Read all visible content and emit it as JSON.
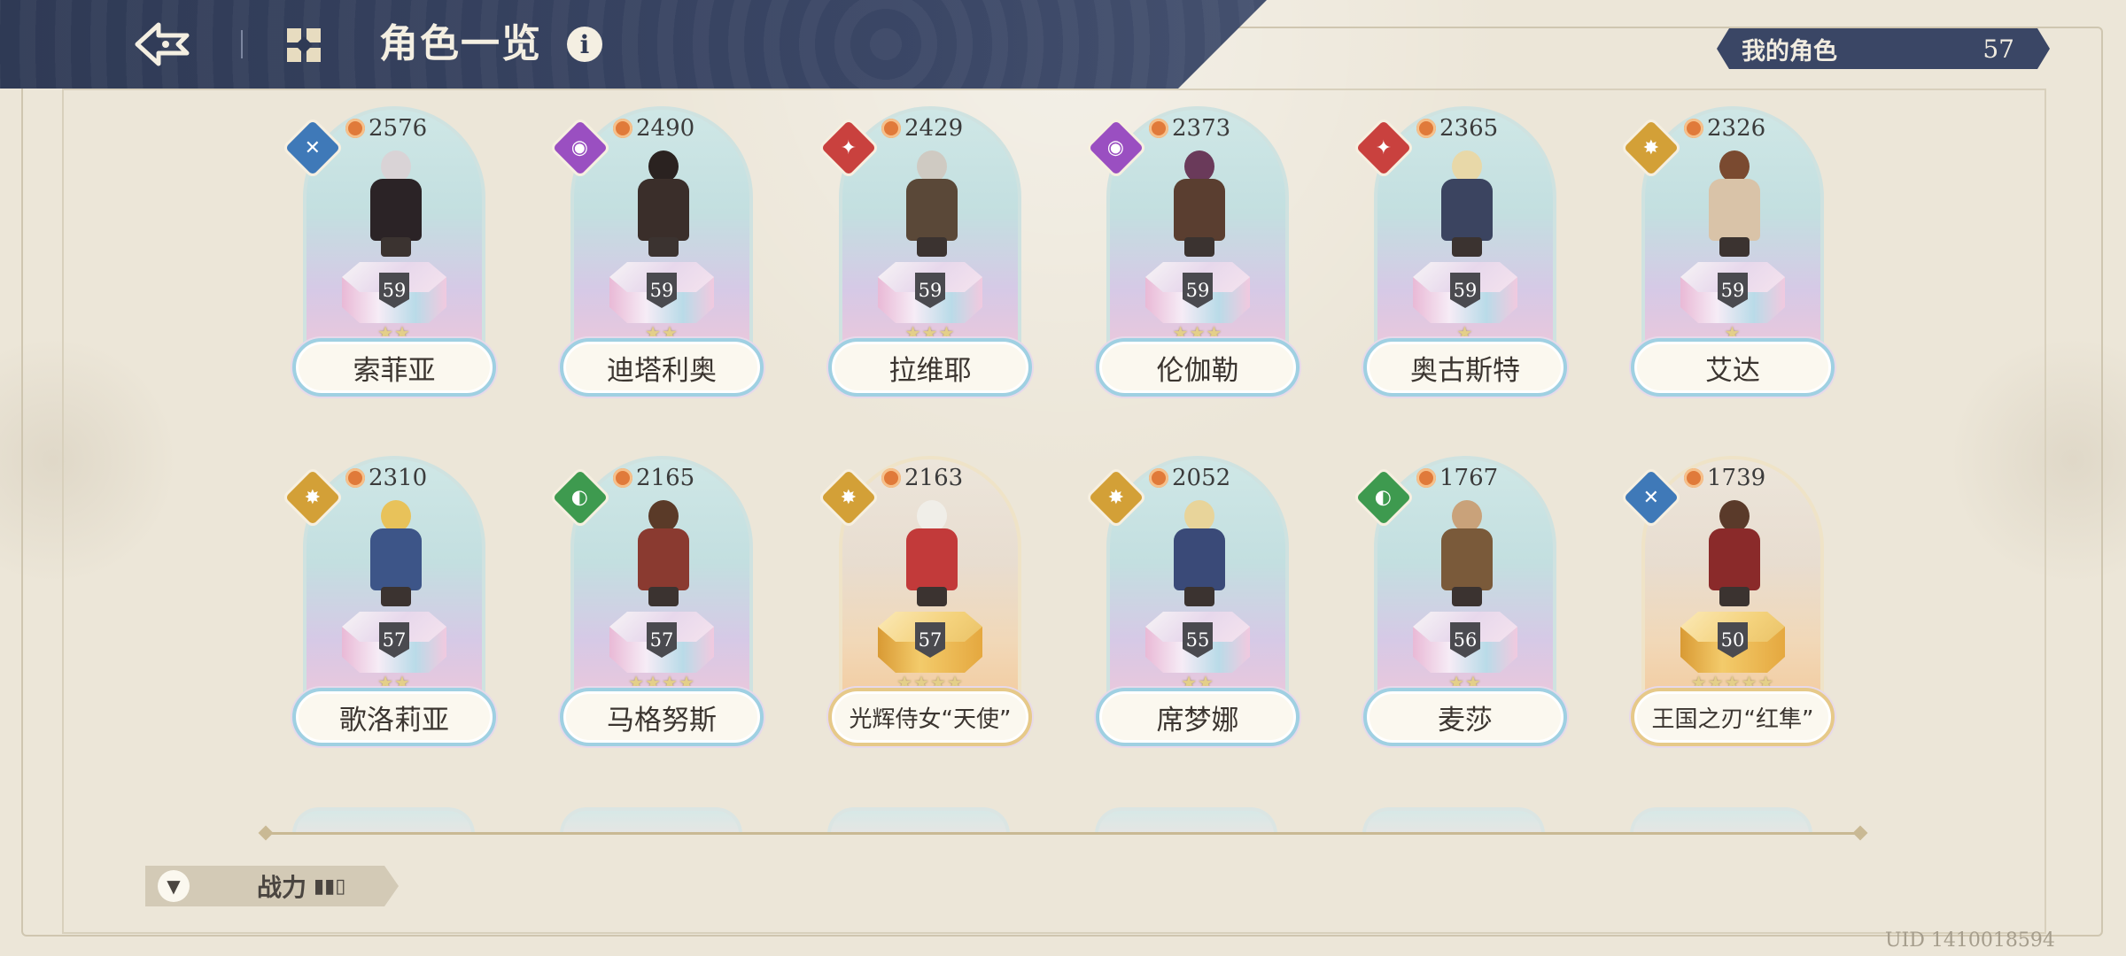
{
  "header": {
    "title": "角色一览",
    "info": "i"
  },
  "my_characters": {
    "label": "我的角色",
    "count": "57"
  },
  "characters": [
    {
      "name": "索菲亚",
      "power": "2576",
      "level": "59",
      "element": "water",
      "stars": 2,
      "rarity": "teal"
    },
    {
      "name": "迪塔利奥",
      "power": "2490",
      "level": "59",
      "element": "dark",
      "stars": 2,
      "rarity": "teal"
    },
    {
      "name": "拉维耶",
      "power": "2429",
      "level": "59",
      "element": "fire",
      "stars": 3,
      "rarity": "teal"
    },
    {
      "name": "伦伽勒",
      "power": "2373",
      "level": "59",
      "element": "dark",
      "stars": 3,
      "rarity": "teal"
    },
    {
      "name": "奥古斯特",
      "power": "2365",
      "level": "59",
      "element": "fire",
      "stars": 1,
      "rarity": "teal"
    },
    {
      "name": "艾达",
      "power": "2326",
      "level": "59",
      "element": "light",
      "stars": 1,
      "rarity": "teal"
    },
    {
      "name": "歌洛莉亚",
      "power": "2310",
      "level": "57",
      "element": "light",
      "stars": 2,
      "rarity": "teal"
    },
    {
      "name": "马格努斯",
      "power": "2165",
      "level": "57",
      "element": "wind",
      "stars": 4,
      "rarity": "teal"
    },
    {
      "name": "光辉侍女“天使”",
      "power": "2163",
      "level": "57",
      "element": "light",
      "stars": 4,
      "rarity": "gold"
    },
    {
      "name": "席梦娜",
      "power": "2052",
      "level": "55",
      "element": "light",
      "stars": 2,
      "rarity": "teal"
    },
    {
      "name": "麦莎",
      "power": "1767",
      "level": "56",
      "element": "wind",
      "stars": 2,
      "rarity": "teal"
    },
    {
      "name": "王国之刃“红隼”",
      "power": "1739",
      "level": "50",
      "element": "water",
      "stars": 5,
      "rarity": "gold"
    }
  ],
  "sort": {
    "label": "战力"
  },
  "uid": "UID 1410018594",
  "colors": {
    "header_bg": "#2f3a55",
    "page_bg": "#ece6d8",
    "water": "#3f79b8",
    "dark": "#9a4fc1",
    "fire": "#c9413e",
    "light": "#d3a037",
    "wind": "#3e9a4f"
  },
  "icons": {
    "back": "back-arrow-icon",
    "menu": "grid-menu-icon",
    "filter": "filter-icon",
    "sort": "bar-sort-icon"
  }
}
